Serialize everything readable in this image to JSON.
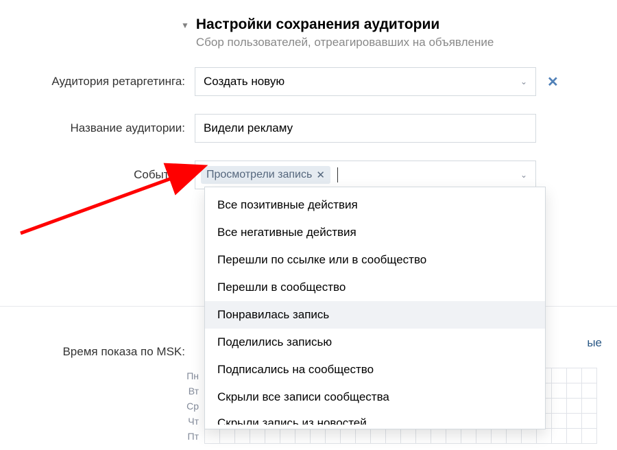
{
  "header": {
    "title": "Настройки сохранения аудитории",
    "subtitle": "Сбор пользователей, отреагировавших на объявление"
  },
  "form": {
    "retarget": {
      "label": "Аудитория ретаргетинга:",
      "selected": "Создать новую"
    },
    "name": {
      "label": "Название аудитории:",
      "value": "Видели рекламу"
    },
    "events": {
      "label": "События:",
      "chip": "Просмотрели запись",
      "options": [
        "Все позитивные действия",
        "Все негативные действия",
        "Перешли по ссылке или в сообщество",
        "Перешли в сообщество",
        "Понравилась запись",
        "Поделились записью",
        "Подписались на сообщество",
        "Скрыли все записи сообщества",
        "Скрыли запись из новостей"
      ],
      "hover_index": 4
    }
  },
  "schedule": {
    "time_label": "Время показа по MSK:",
    "weekend_link": "ые",
    "days": [
      "Пн",
      "Вт",
      "Ср",
      "Чт",
      "Пт"
    ]
  }
}
